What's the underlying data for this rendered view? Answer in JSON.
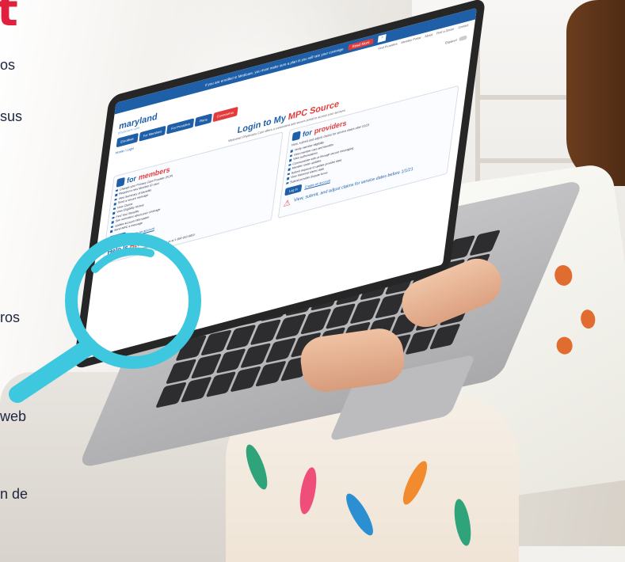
{
  "left_text": {
    "heading_char": "t",
    "fragments": [
      "os",
      "sus",
      "ros",
      "web",
      "n de"
    ]
  },
  "laptop_screen": {
    "promo_text": "If you are enrolled in Medicare, you must make sure a plan is you will rate your coverage",
    "promo_button": "Read More",
    "promo_search_icon": "search-icon",
    "util_links": [
      "Find Providers",
      "Member Portal",
      "About",
      "Find a Doctor",
      "Contact"
    ],
    "logo_name": "maryland",
    "logo_sub": "physicians care",
    "toggle_label": "Espanol",
    "nav": [
      "Enrollees",
      "For Members",
      "For Providers",
      "Plans",
      "Coronavirus"
    ],
    "breadcrumb": "Home / Login",
    "title_prefix": "Login to My ",
    "title_accent": "MPC Source",
    "intro": "Welcome! Physicians Care offers a convenient and secure portal to access your account.",
    "members": {
      "heading_prefix": "for ",
      "heading_accent": "members",
      "bullets": [
        "Change your Primary Care Provider (PCP)",
        "Request a new Member ID card",
        "View Summary of Benefits",
        "Send a secure message",
        "View Claims",
        "View Eligibility History",
        "Find Your Benefits",
        "See reminders about your coverage",
        "Update account information",
        "Send MPC a message"
      ],
      "login_label": "Log In",
      "create_label": "Create an account"
    },
    "providers": {
      "heading_prefix": "for ",
      "heading_accent": "providers",
      "intro": "View, submit and adjust claims for service dates after 01/21",
      "bullets": [
        "Verify member eligibility",
        "View member care and benefits",
        "View authorizations",
        "Communicate with us through secure messaging",
        "Member roster updates",
        "Submit requests to update provider data",
        "View historical claims data",
        "Submit provider dispute forms"
      ],
      "login_label": "Log In",
      "create_label": "Create an account",
      "alert_text": "View, submit, and adjust claims for service dates before 1/1/21"
    },
    "help": {
      "title_prefix": "Help Is ",
      "title_accent": "Here!",
      "text": "If you need help with the member portal, contact us at 1-800-953-8854"
    }
  },
  "colors": {
    "brand_blue": "#1f5fa8",
    "brand_red": "#e23b3b",
    "magnifier": "#3ec8e0"
  },
  "icons": {
    "magnifier": "magnifying-glass-icon",
    "alert": "warning-triangle-icon"
  }
}
